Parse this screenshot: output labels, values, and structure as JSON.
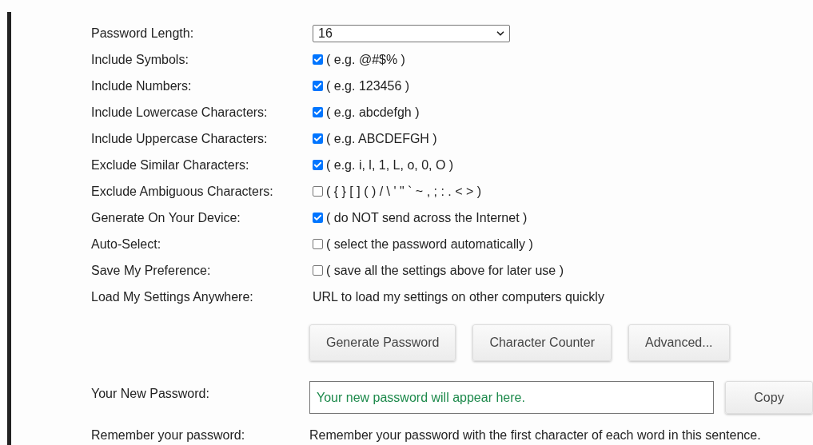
{
  "settings": [
    {
      "kind": "select",
      "label": "Password Length:",
      "value": "16"
    },
    {
      "kind": "checkbox",
      "label": "Include Symbols:",
      "checked": true,
      "hint": "( e.g. @#$% )"
    },
    {
      "kind": "checkbox",
      "label": "Include Numbers:",
      "checked": true,
      "hint": "( e.g. 123456 )"
    },
    {
      "kind": "checkbox",
      "label": "Include Lowercase Characters:",
      "checked": true,
      "hint": "( e.g. abcdefgh )"
    },
    {
      "kind": "checkbox",
      "label": "Include Uppercase Characters:",
      "checked": true,
      "hint": "( e.g. ABCDEFGH )"
    },
    {
      "kind": "checkbox",
      "label": "Exclude Similar Characters:",
      "checked": true,
      "hint": "( e.g. i, l, 1, L, o, 0, O )"
    },
    {
      "kind": "checkbox",
      "label": "Exclude Ambiguous Characters:",
      "checked": false,
      "hint": "( { } [ ] ( ) / \\ ' \" ` ~ , ; : . < > )"
    },
    {
      "kind": "checkbox",
      "label": "Generate On Your Device:",
      "checked": true,
      "hint": "( do NOT send across the Internet )"
    },
    {
      "kind": "checkbox",
      "label": "Auto-Select:",
      "checked": false,
      "hint": "( select the password automatically )"
    },
    {
      "kind": "checkbox",
      "label": "Save My Preference:",
      "checked": false,
      "hint": "( save all the settings above for later use )"
    },
    {
      "kind": "text",
      "label": "Load My Settings Anywhere:",
      "value": "URL to load my settings on other computers quickly"
    }
  ],
  "buttons": [
    "Generate Password",
    "Character Counter",
    "Advanced..."
  ],
  "new_password": {
    "label": "Your New Password:",
    "placeholder": "Your new password will appear here.",
    "copy": "Copy"
  },
  "remember": {
    "label": "Remember your password:",
    "text": "Remember your password with the first character of each word in this sentence."
  }
}
